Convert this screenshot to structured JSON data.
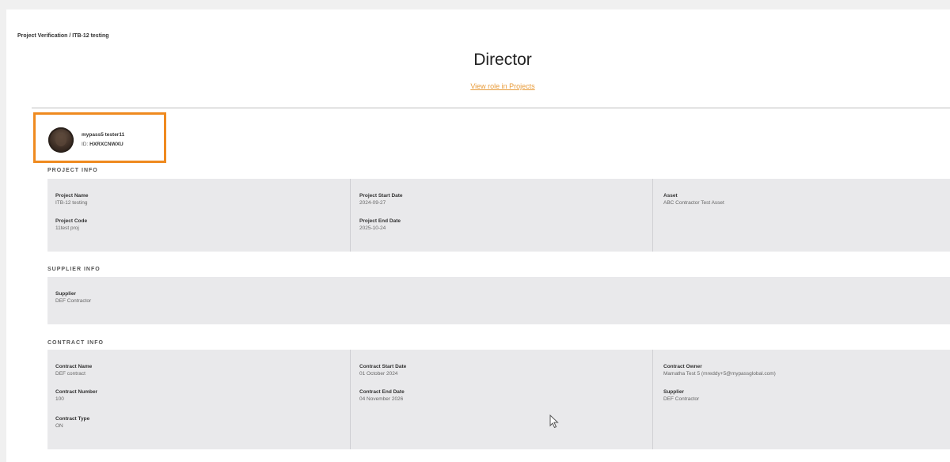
{
  "breadcrumb": "Project Verification / ITB-12 testing",
  "title": "Director",
  "view_role_link": "View role in Projects",
  "user": {
    "name": "mypass5 tester11",
    "id_label": "ID:",
    "id_value": "HXRXCNWXU"
  },
  "project_info": {
    "header": "PROJECT INFO",
    "fields": {
      "project_name": {
        "label": "Project Name",
        "value": "ITB-12 testing"
      },
      "project_code": {
        "label": "Project Code",
        "value": "11test proj"
      },
      "start_date": {
        "label": "Project Start Date",
        "value": "2024-09-27"
      },
      "end_date": {
        "label": "Project End Date",
        "value": "2025-10-24"
      },
      "asset": {
        "label": "Asset",
        "value": "ABC Contractor Test Asset"
      }
    }
  },
  "supplier_info": {
    "header": "SUPPLIER INFO",
    "fields": {
      "supplier": {
        "label": "Supplier",
        "value": "DEF Contractor"
      }
    }
  },
  "contract_info": {
    "header": "CONTRACT INFO",
    "fields": {
      "contract_name": {
        "label": "Contract Name",
        "value": "DEF contract"
      },
      "contract_number": {
        "label": "Contract Number",
        "value": "100"
      },
      "contract_type": {
        "label": "Contract Type",
        "value": "ON"
      },
      "contract_start": {
        "label": "Contract Start Date",
        "value": "01 October 2024"
      },
      "contract_end": {
        "label": "Contract End Date",
        "value": "04 November 2026"
      },
      "contract_owner": {
        "label": "Contract Owner",
        "value": "Mamatha Test 5 (mreddy+5@mypassglobal.com)"
      },
      "supplier": {
        "label": "Supplier",
        "value": "DEF Contractor"
      }
    }
  }
}
